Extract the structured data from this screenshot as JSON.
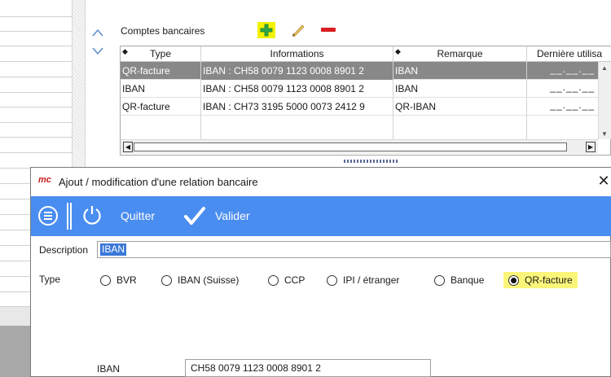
{
  "accounts": {
    "section_title": "Comptes bancaires",
    "columns": [
      "Type",
      "Informations",
      "Remarque",
      "Dernière utilisa"
    ],
    "rows": [
      {
        "type": "QR-facture",
        "info": "IBAN : CH58 0079 1123 0008 8901 2",
        "remark": "IBAN",
        "date": "__.__.__",
        "selected": true
      },
      {
        "type": "IBAN",
        "info": "IBAN : CH58 0079 1123 0008 8901 2",
        "remark": "IBAN",
        "date": "__.__.__",
        "selected": false
      },
      {
        "type": "QR-facture",
        "info": "IBAN : CH73 3195 5000 0073 2412 9",
        "remark": "QR-IBAN",
        "date": "__.__.__",
        "selected": false
      }
    ],
    "icons": {
      "add": "plus-icon",
      "edit": "pencil-icon",
      "delete": "minus-icon",
      "up": "arrow-up-icon",
      "down": "arrow-down-icon"
    }
  },
  "dialog": {
    "title": "Ajout / modification d'une relation bancaire",
    "logo": "mc",
    "close": "✕",
    "toolbar": {
      "quit_label": "Quitter",
      "validate_label": "Valider"
    },
    "description": {
      "label": "Description",
      "value": "IBAN"
    },
    "type": {
      "label": "Type",
      "options": [
        "BVR",
        "IBAN (Suisse)",
        "CCP",
        "IPI / étranger",
        "Banque",
        "QR-facture"
      ],
      "selected": "QR-facture"
    },
    "iban": {
      "label": "IBAN",
      "value": "CH58 0079 1123 0008 8901 2"
    }
  },
  "colors": {
    "toolbar": "#4a8df0",
    "highlight": "#fbf57a",
    "selected_row": "#888888",
    "delete": "#d81e1e",
    "add": "#2ca84a"
  }
}
